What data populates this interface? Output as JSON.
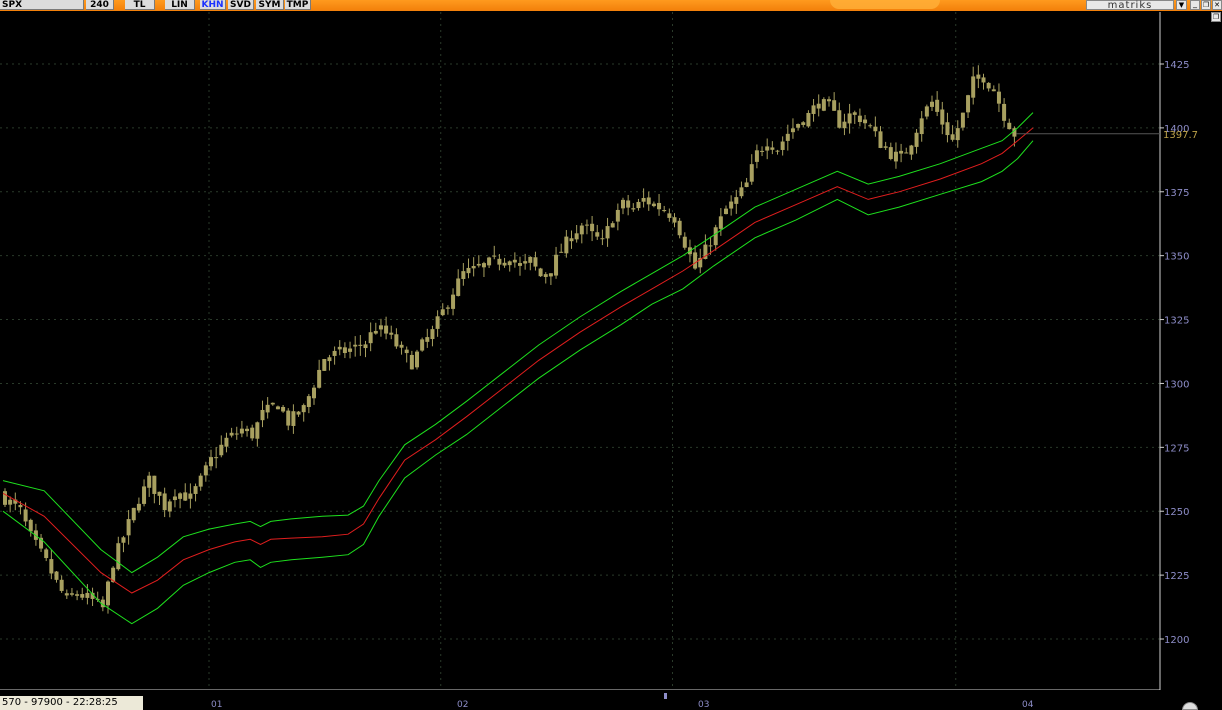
{
  "toolbar": {
    "symbol": "SPX",
    "period": "240",
    "buttons": [
      "TL",
      "LIN",
      "KHN",
      "SVD",
      "SYM",
      "TMP"
    ],
    "active_button": "KHN",
    "brand": "matriks",
    "dropdown_icon": "chevron-down-icon",
    "window_controls": [
      "minimize-icon",
      "restore-icon",
      "close-icon"
    ]
  },
  "status": {
    "text": "570 - 97900 - 22:28:25"
  },
  "time_axis": {
    "labels": [
      "01",
      "02",
      "03",
      "04"
    ]
  },
  "colors": {
    "background": "#000000",
    "candle": "#a8a060",
    "upper_band": "#1ee01e",
    "middle_line": "#e01e1e",
    "lower_band": "#1ee01e",
    "grid": "#2a3a2a",
    "axis_text": "#8d8dc8",
    "last_price": "#bda24a"
  },
  "chart_data": {
    "type": "candlestick",
    "title": "",
    "xlabel": "",
    "ylabel": "",
    "ylim": [
      1185,
      1440
    ],
    "y_ticks": [
      1200,
      1225,
      1250,
      1275,
      1300,
      1325,
      1350,
      1375,
      1400,
      1425
    ],
    "last_price": "1397.7",
    "n_bars": 208,
    "period_starts": [
      {
        "label": "01",
        "bar": 40
      },
      {
        "label": "02",
        "bar": 85
      },
      {
        "label": "03",
        "bar": 130
      },
      {
        "label": "04",
        "bar": 185
      }
    ],
    "close_anchors": [
      [
        0,
        1255
      ],
      [
        3,
        1250
      ],
      [
        5,
        1240
      ],
      [
        8,
        1230
      ],
      [
        10,
        1222
      ],
      [
        12,
        1215
      ],
      [
        14,
        1218
      ],
      [
        17,
        1215
      ],
      [
        19,
        1212
      ],
      [
        21,
        1230
      ],
      [
        23,
        1240
      ],
      [
        26,
        1255
      ],
      [
        28,
        1262
      ],
      [
        31,
        1252
      ],
      [
        33,
        1258
      ],
      [
        36,
        1255
      ],
      [
        38,
        1262
      ],
      [
        40,
        1270
      ],
      [
        43,
        1278
      ],
      [
        46,
        1282
      ],
      [
        48,
        1280
      ],
      [
        50,
        1288
      ],
      [
        53,
        1292
      ],
      [
        55,
        1285
      ],
      [
        58,
        1290
      ],
      [
        60,
        1300
      ],
      [
        62,
        1310
      ],
      [
        65,
        1312
      ],
      [
        68,
        1314
      ],
      [
        70,
        1316
      ],
      [
        72,
        1322
      ],
      [
        75,
        1318
      ],
      [
        77,
        1312
      ],
      [
        79,
        1308
      ],
      [
        81,
        1315
      ],
      [
        83,
        1320
      ],
      [
        85,
        1328
      ],
      [
        87,
        1336
      ],
      [
        89,
        1343
      ],
      [
        92,
        1345
      ],
      [
        94,
        1347
      ],
      [
        96,
        1348
      ],
      [
        98,
        1350
      ],
      [
        100,
        1345
      ],
      [
        102,
        1348
      ],
      [
        104,
        1342
      ],
      [
        106,
        1345
      ],
      [
        108,
        1352
      ],
      [
        110,
        1358
      ],
      [
        112,
        1362
      ],
      [
        114,
        1358
      ],
      [
        116,
        1355
      ],
      [
        118,
        1365
      ],
      [
        120,
        1370
      ],
      [
        122,
        1368
      ],
      [
        124,
        1372
      ],
      [
        126,
        1370
      ],
      [
        128,
        1368
      ],
      [
        130,
        1365
      ],
      [
        132,
        1355
      ],
      [
        134,
        1345
      ],
      [
        136,
        1352
      ],
      [
        138,
        1360
      ],
      [
        140,
        1368
      ],
      [
        142,
        1372
      ],
      [
        144,
        1378
      ],
      [
        146,
        1390
      ],
      [
        148,
        1395
      ],
      [
        150,
        1392
      ],
      [
        152,
        1398
      ],
      [
        154,
        1402
      ],
      [
        156,
        1405
      ],
      [
        158,
        1410
      ],
      [
        160,
        1408
      ],
      [
        162,
        1402
      ],
      [
        164,
        1405
      ],
      [
        166,
        1404
      ],
      [
        168,
        1400
      ],
      [
        170,
        1394
      ],
      [
        172,
        1390
      ],
      [
        174,
        1388
      ],
      [
        176,
        1395
      ],
      [
        178,
        1405
      ],
      [
        180,
        1410
      ],
      [
        182,
        1402
      ],
      [
        184,
        1395
      ],
      [
        186,
        1405
      ],
      [
        188,
        1418
      ],
      [
        190,
        1420
      ],
      [
        192,
        1415
      ],
      [
        194,
        1405
      ],
      [
        196,
        1397.7
      ]
    ],
    "series": [
      {
        "name": "upper",
        "points": [
          [
            0,
            1262
          ],
          [
            8,
            1258
          ],
          [
            19,
            1235
          ],
          [
            25,
            1226
          ],
          [
            30,
            1232
          ],
          [
            35,
            1240
          ],
          [
            40,
            1243
          ],
          [
            45,
            1245
          ],
          [
            48,
            1246
          ],
          [
            50,
            1244
          ],
          [
            52,
            1246
          ],
          [
            56,
            1247
          ],
          [
            62,
            1248
          ],
          [
            67,
            1248.5
          ],
          [
            70,
            1252
          ],
          [
            73,
            1262
          ],
          [
            78,
            1276
          ],
          [
            84,
            1284
          ],
          [
            90,
            1293
          ],
          [
            97,
            1304
          ],
          [
            104,
            1315
          ],
          [
            112,
            1326
          ],
          [
            120,
            1336
          ],
          [
            126,
            1343
          ],
          [
            132,
            1350
          ],
          [
            138,
            1358
          ],
          [
            146,
            1369
          ],
          [
            154,
            1376
          ],
          [
            162,
            1383
          ],
          [
            168,
            1378
          ],
          [
            174,
            1381
          ],
          [
            182,
            1386
          ],
          [
            190,
            1392
          ],
          [
            194,
            1395
          ],
          [
            197,
            1400
          ],
          [
            200,
            1406
          ]
        ]
      },
      {
        "name": "middle",
        "points": [
          [
            0,
            1257
          ],
          [
            8,
            1248
          ],
          [
            19,
            1226
          ],
          [
            25,
            1218
          ],
          [
            30,
            1223
          ],
          [
            35,
            1231
          ],
          [
            40,
            1235
          ],
          [
            45,
            1238
          ],
          [
            48,
            1239
          ],
          [
            50,
            1237
          ],
          [
            52,
            1239
          ],
          [
            56,
            1239.5
          ],
          [
            62,
            1240
          ],
          [
            67,
            1241
          ],
          [
            70,
            1245
          ],
          [
            73,
            1255
          ],
          [
            78,
            1270
          ],
          [
            84,
            1278
          ],
          [
            90,
            1287
          ],
          [
            97,
            1298
          ],
          [
            104,
            1309
          ],
          [
            112,
            1320
          ],
          [
            120,
            1330
          ],
          [
            126,
            1337
          ],
          [
            132,
            1344
          ],
          [
            138,
            1352
          ],
          [
            146,
            1363
          ],
          [
            154,
            1370
          ],
          [
            162,
            1377
          ],
          [
            168,
            1372
          ],
          [
            174,
            1375
          ],
          [
            182,
            1380
          ],
          [
            190,
            1386
          ],
          [
            194,
            1390
          ],
          [
            197,
            1395
          ],
          [
            200,
            1400
          ]
        ]
      },
      {
        "name": "lower",
        "points": [
          [
            0,
            1250
          ],
          [
            8,
            1238
          ],
          [
            19,
            1214
          ],
          [
            25,
            1206
          ],
          [
            30,
            1212
          ],
          [
            35,
            1221
          ],
          [
            40,
            1226
          ],
          [
            45,
            1230
          ],
          [
            48,
            1231
          ],
          [
            50,
            1228
          ],
          [
            52,
            1230
          ],
          [
            56,
            1231
          ],
          [
            62,
            1232
          ],
          [
            67,
            1233
          ],
          [
            70,
            1237
          ],
          [
            73,
            1248
          ],
          [
            78,
            1263
          ],
          [
            84,
            1272
          ],
          [
            90,
            1280
          ],
          [
            97,
            1291
          ],
          [
            104,
            1302
          ],
          [
            112,
            1313
          ],
          [
            120,
            1323
          ],
          [
            126,
            1331
          ],
          [
            132,
            1337
          ],
          [
            138,
            1346
          ],
          [
            146,
            1357
          ],
          [
            154,
            1364
          ],
          [
            162,
            1372
          ],
          [
            168,
            1366
          ],
          [
            174,
            1369
          ],
          [
            182,
            1374
          ],
          [
            190,
            1379
          ],
          [
            194,
            1383
          ],
          [
            197,
            1388
          ],
          [
            200,
            1395
          ]
        ]
      }
    ]
  }
}
